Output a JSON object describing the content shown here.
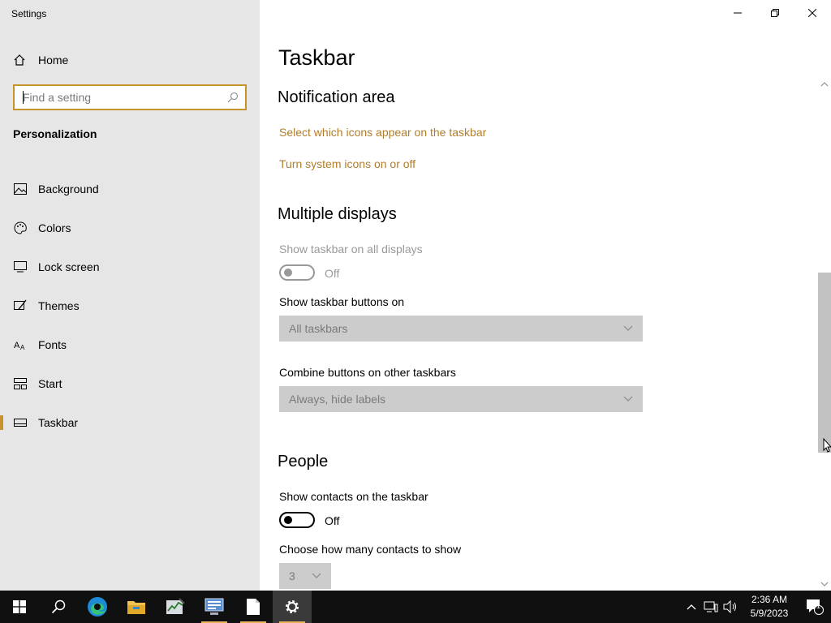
{
  "window": {
    "title": "Settings"
  },
  "sidebar": {
    "home_label": "Home",
    "search_placeholder": "Find a setting",
    "section_title": "Personalization",
    "items": [
      {
        "label": "Background",
        "icon": "picture-icon"
      },
      {
        "label": "Colors",
        "icon": "palette-icon"
      },
      {
        "label": "Lock screen",
        "icon": "monitor-icon"
      },
      {
        "label": "Themes",
        "icon": "brush-icon"
      },
      {
        "label": "Fonts",
        "icon": "font-icon"
      },
      {
        "label": "Start",
        "icon": "start-icon"
      },
      {
        "label": "Taskbar",
        "icon": "taskbar-icon",
        "active": true
      }
    ]
  },
  "main": {
    "page_title": "Taskbar",
    "notification_area": {
      "heading": "Notification area",
      "link1": "Select which icons appear on the taskbar",
      "link2": "Turn system icons on or off"
    },
    "multiple_displays": {
      "heading": "Multiple displays",
      "show_all_label": "Show taskbar on all displays",
      "show_all_state": "Off",
      "buttons_on_label": "Show taskbar buttons on",
      "buttons_on_value": "All taskbars",
      "combine_label": "Combine buttons on other taskbars",
      "combine_value": "Always, hide labels"
    },
    "people": {
      "heading": "People",
      "contacts_label": "Show contacts on the taskbar",
      "contacts_state": "Off",
      "count_label": "Choose how many contacts to show",
      "count_value": "3"
    }
  },
  "taskbar": {
    "time": "2:36 AM",
    "date": "5/9/2023",
    "notification_count": "1"
  },
  "colors": {
    "accent": "#c8912c",
    "link": "#b07d2a"
  }
}
